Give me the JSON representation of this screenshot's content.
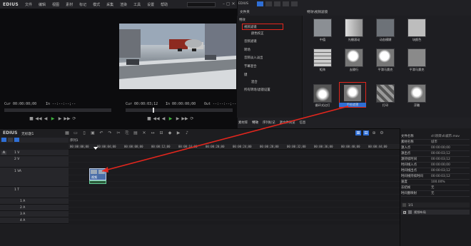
{
  "app": {
    "logo": "EDIUS"
  },
  "menu": [
    "文件",
    "编辑",
    "视图",
    "素材",
    "标记",
    "模式",
    "采集",
    "渲染",
    "工具",
    "设置",
    "帮助"
  ],
  "preview": {
    "cur_tc": "Cur 00:00:00;00",
    "in_tc": "In --:--:--;--",
    "cur_tc2": "Cur 00:00:03;12",
    "in_tc2": "In 00:00:00;00",
    "out_tc": "Out --:--:--;--",
    "dur_tc": "Dur --:--:--;--"
  },
  "bin": {
    "header": "文件夹",
    "effects_header": "特效\\视频滤镜",
    "tree": [
      "特效",
      "视频滤镜",
      "颜色校正",
      "音频滤镜",
      "转场",
      "音频淡入淡出",
      "字幕混合",
      "键",
      "混合",
      "所有转场/滤镜设置"
    ],
    "effects": [
      {
        "label": "中值",
        "highlight": false
      },
      {
        "label": "光栅滚动",
        "highlight": false
      },
      {
        "label": "动态模糊",
        "highlight": false
      },
      {
        "label": "块颜色",
        "highlight": false
      },
      {
        "label": "矩阵",
        "highlight": false
      },
      {
        "label": "去隔行",
        "highlight": false
      },
      {
        "label": "平滑马赛克",
        "highlight": false
      },
      {
        "label": "平滑马赛克",
        "highlight": false
      },
      {
        "label": "循环式幻灯",
        "highlight": false
      },
      {
        "label": "手绘遮罩",
        "highlight": true
      },
      {
        "label": "打印",
        "highlight": false
      },
      {
        "label": "浮雕",
        "highlight": false
      }
    ],
    "tabs": [
      "素材库",
      "特效",
      "序列标记",
      "源文件浏览",
      "信息"
    ]
  },
  "timeline": {
    "logo": "EDIUS",
    "project_name": "无标题1",
    "sequence": "序列1",
    "ruler": [
      "00:00:00;00",
      "00:00:04;00",
      "00:00:08;00",
      "00:00:12;00",
      "00:00:16;00",
      "00:00:20;00",
      "00:00:24;00",
      "00:00:28;00",
      "00:00:32;00",
      "00:00:36;00",
      "00:00:40;00",
      "00:00:44;00"
    ],
    "tracks": [
      {
        "name": "1 V",
        "kind": "video"
      },
      {
        "name": "2 V",
        "kind": "video"
      },
      {
        "name": "1 VA",
        "kind": "va"
      },
      {
        "name": "1 T",
        "kind": "title"
      },
      {
        "name": "1 A",
        "kind": "audio"
      },
      {
        "name": "2 A",
        "kind": "audio"
      },
      {
        "name": "3 A",
        "kind": "audio"
      },
      {
        "name": "4 A",
        "kind": "audio"
      }
    ],
    "clip_label": "视频"
  },
  "info_panel": {
    "rows": [
      {
        "k": "文件名称",
        "v": "d:\\项目\\4\\城市.mov"
      },
      {
        "k": "素材名称",
        "v": "城市"
      },
      {
        "k": "源入点",
        "v": "00:00:00;00"
      },
      {
        "k": "源出点",
        "v": "00:00:03;12"
      },
      {
        "k": "源持续时间",
        "v": "00:00:03;12"
      },
      {
        "k": "时间线入点",
        "v": "00:00:00;00"
      },
      {
        "k": "时间线出点",
        "v": "00:00:03;12"
      },
      {
        "k": "时间线持续时间",
        "v": "00:00:03;12"
      },
      {
        "k": "速度",
        "v": "100.00%"
      },
      {
        "k": "冻结帧",
        "v": "无"
      },
      {
        "k": "时间重映射",
        "v": "无"
      }
    ],
    "page": "1/1",
    "filter_item": "视频布局"
  },
  "colors": {
    "highlight_red": "#e3261d",
    "accent_blue": "#2f6fd6"
  }
}
